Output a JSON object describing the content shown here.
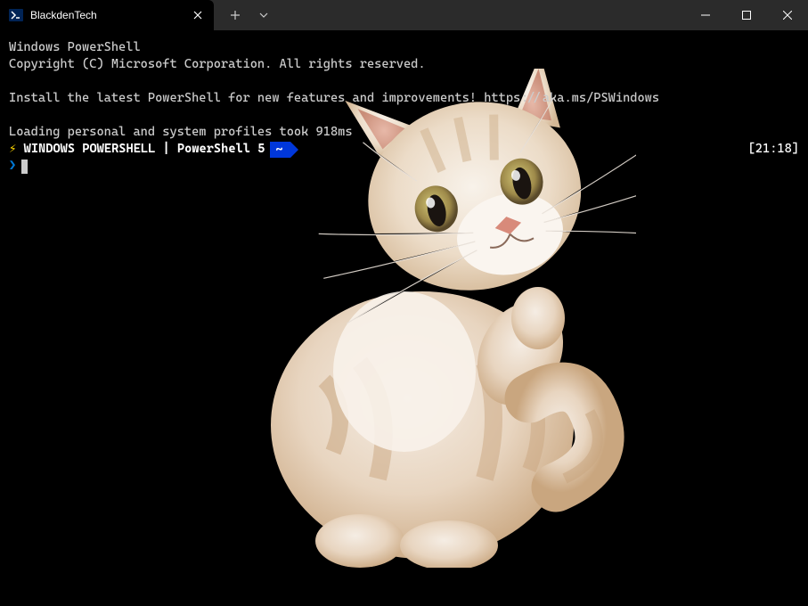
{
  "tab": {
    "title": "BlackdenTech"
  },
  "terminal": {
    "header1": "Windows PowerShell",
    "header2": "Copyright (C) Microsoft Corporation. All rights reserved.",
    "install_msg": "Install the latest PowerShell for new features and improvements! https://aka.ms/PSWindows",
    "profile_msg": "Loading personal and system profiles took 918ms",
    "prompt_bolt": "⚡",
    "prompt_text": "WINDOWS POWERSHELL | PowerShell 5",
    "prompt_tilde": "~",
    "timestamp": "[21:18]",
    "input_prompt": "❯"
  }
}
